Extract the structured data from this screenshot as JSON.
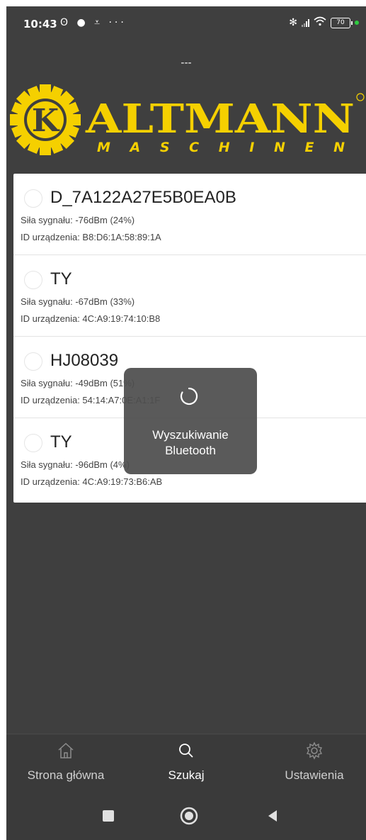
{
  "status_bar": {
    "time": "10:43",
    "notifications": "ʘ ● ⩡ ···",
    "battery": "70"
  },
  "header": {
    "title": "---",
    "logo_text": "ALTMANN",
    "logo_letter": "K",
    "logo_subtitle": "M A S C H I N E N"
  },
  "devices": [
    {
      "name": "D_7A122A27E5B0EA0B",
      "signal": "Siła sygnału: -76dBm (24%)",
      "id": "ID urządzenia: B8:D6:1A:58:89:1A"
    },
    {
      "name": "TY",
      "signal": "Siła sygnału: -67dBm (33%)",
      "id": "ID urządzenia: 4C:A9:19:74:10:B8"
    },
    {
      "name": "HJ08039",
      "signal": "Siła sygnału: -49dBm (51%)",
      "id": "ID urządzenia: 54:14:A7:0E:A1:1F"
    },
    {
      "name": "TY",
      "signal": "Siła sygnału: -96dBm (4%)",
      "id": "ID urządzenia: 4C:A9:19:73:B6:AB"
    }
  ],
  "loading": {
    "text_line1": "Wyszukiwanie",
    "text_line2": "Bluetooth"
  },
  "bottom_nav": {
    "home": "Strona główna",
    "search": "Szukaj",
    "settings": "Ustawienia"
  },
  "colors": {
    "brand_yellow": "#f5d000",
    "background": "#3f3f3f"
  }
}
